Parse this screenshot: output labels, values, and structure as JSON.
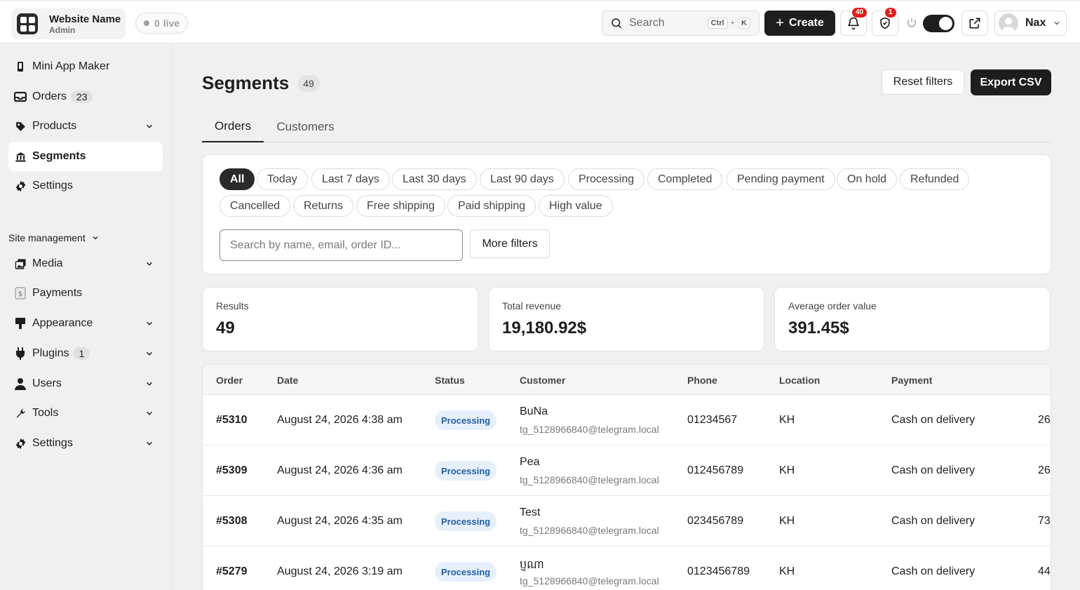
{
  "topbar": {
    "site_name": "Website Name",
    "site_role": "Admin",
    "live_count": "0",
    "live_label": "live",
    "search_label": "Search",
    "kbd_ctrl": "Ctrl",
    "kbd_plus": "+",
    "kbd_k": "K",
    "create_label": "Create",
    "notifications_count": "40",
    "security_count": "1",
    "user_name": "Nax"
  },
  "sidebar": {
    "items": [
      {
        "label": "Mini App Maker",
        "icon": "phone-icon"
      },
      {
        "label": "Orders",
        "icon": "inbox-icon",
        "count": "23"
      },
      {
        "label": "Products",
        "icon": "tag-icon"
      },
      {
        "label": "Segments",
        "icon": "bank-icon",
        "active": true
      },
      {
        "label": "Settings",
        "icon": "gear-icon"
      }
    ],
    "section_label": "Site management",
    "site_items": [
      {
        "label": "Media",
        "icon": "media-icon"
      },
      {
        "label": "Payments",
        "icon": "payment-icon"
      },
      {
        "label": "Appearance",
        "icon": "brush-icon"
      },
      {
        "label": "Plugins",
        "icon": "plug-icon",
        "count": "1"
      },
      {
        "label": "Users",
        "icon": "user-icon"
      },
      {
        "label": "Tools",
        "icon": "wrench-icon"
      },
      {
        "label": "Settings",
        "icon": "gear-icon"
      }
    ]
  },
  "main": {
    "title": "Segments",
    "title_count": "49",
    "reset_label": "Reset filters",
    "export_label": "Export CSV",
    "tabs": [
      "Orders",
      "Customers"
    ],
    "chips": [
      "All",
      "Today",
      "Last 7 days",
      "Last 30 days",
      "Last 90 days",
      "Processing",
      "Completed",
      "Pending payment",
      "On hold",
      "Refunded",
      "Cancelled",
      "Returns",
      "Free shipping",
      "Paid shipping",
      "High value"
    ],
    "search_placeholder": "Search by name, email, order ID...",
    "more_filters_label": "More filters",
    "stats": [
      {
        "label": "Results",
        "value": "49"
      },
      {
        "label": "Total revenue",
        "value": "19,180.92$"
      },
      {
        "label": "Average order value",
        "value": "391.45$"
      }
    ],
    "table": {
      "headers": [
        "Order",
        "Date",
        "Status",
        "Customer",
        "Phone",
        "Location",
        "Payment"
      ],
      "rows": [
        {
          "order": "#5310",
          "date": "August 24, 2026 4:38 am",
          "status": "Processing",
          "name": "BuNa",
          "email": "tg_5128966840@telegram.local",
          "phone": "01234567",
          "location": "KH",
          "payment": "Cash on delivery",
          "extra": "26"
        },
        {
          "order": "#5309",
          "date": "August 24, 2026 4:36 am",
          "status": "Processing",
          "name": "Pea",
          "email": "tg_5128966840@telegram.local",
          "phone": "012456789",
          "location": "KH",
          "payment": "Cash on delivery",
          "extra": "26"
        },
        {
          "order": "#5308",
          "date": "August 24, 2026 4:35 am",
          "status": "Processing",
          "name": "Test",
          "email": "tg_5128966840@telegram.local",
          "phone": "023456789",
          "location": "KH",
          "payment": "Cash on delivery",
          "extra": "73"
        },
        {
          "order": "#5279",
          "date": "August 24, 2026 3:19 am",
          "status": "Processing",
          "name": "ប្ញណា",
          "email": "tg_5128966840@telegram.local",
          "phone": "0123456789",
          "location": "KH",
          "payment": "Cash on delivery",
          "extra": "44"
        }
      ]
    }
  }
}
